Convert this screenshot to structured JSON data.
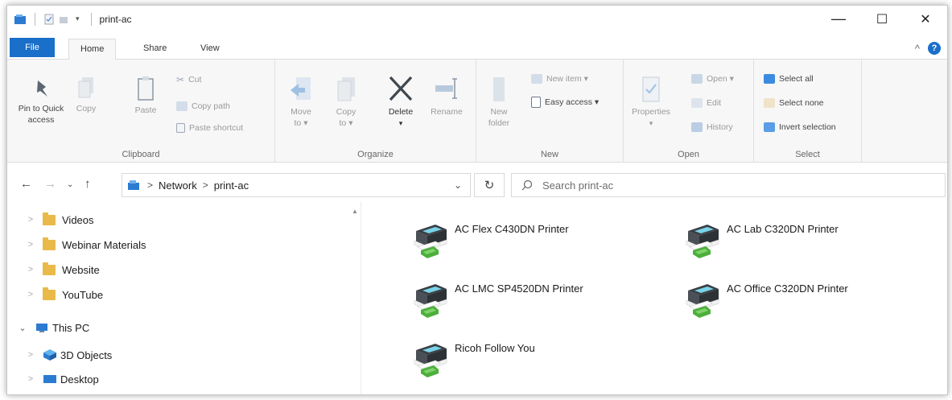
{
  "window": {
    "title": "print-ac",
    "controls": {
      "minimize": "—",
      "maximize": "☐",
      "close": "✕"
    }
  },
  "tabs": [
    {
      "label": "File"
    },
    {
      "label": "Home"
    },
    {
      "label": "Share"
    },
    {
      "label": "View"
    }
  ],
  "ribbon": {
    "clipboard": {
      "label": "Clipboard",
      "pin_line1": "Pin to Quick",
      "pin_line2": "access",
      "copy": "Copy",
      "paste": "Paste",
      "cut": "Cut",
      "copy_path": "Copy path",
      "paste_shortcut": "Paste shortcut"
    },
    "organize": {
      "label": "Organize",
      "move_line1": "Move",
      "move_line2": "to ▾",
      "copy_line1": "Copy",
      "copy_line2": "to ▾",
      "delete": "Delete",
      "delete_arrow": "▾",
      "rename": "Rename"
    },
    "new": {
      "label": "New",
      "folder_line1": "New",
      "folder_line2": "folder",
      "new_item": "New item ▾",
      "easy_access": "Easy access ▾"
    },
    "open": {
      "label": "Open",
      "properties": "Properties",
      "properties_arrow": "▾",
      "open": "Open ▾",
      "edit": "Edit",
      "history": "History"
    },
    "select": {
      "label": "Select",
      "select_all": "Select all",
      "select_none": "Select none",
      "invert": "Invert selection"
    }
  },
  "address": {
    "crumbs": [
      "Network",
      "print-ac"
    ],
    "search_placeholder": "Search print-ac"
  },
  "nav_tree": [
    {
      "label": "Videos"
    },
    {
      "label": "Webinar Materials"
    },
    {
      "label": "Website"
    },
    {
      "label": "YouTube"
    },
    {
      "label": "This PC"
    },
    {
      "label": "3D Objects"
    },
    {
      "label": "Desktop"
    }
  ],
  "printers": [
    {
      "name": "AC Flex C430DN Printer"
    },
    {
      "name": "AC Lab C320DN Printer"
    },
    {
      "name": "AC LMC SP4520DN Printer"
    },
    {
      "name": "AC Office C320DN Printer"
    },
    {
      "name": "Ricoh Follow You"
    }
  ],
  "colors": {
    "accent": "#1a6fc9",
    "folder": "#e9b949"
  }
}
